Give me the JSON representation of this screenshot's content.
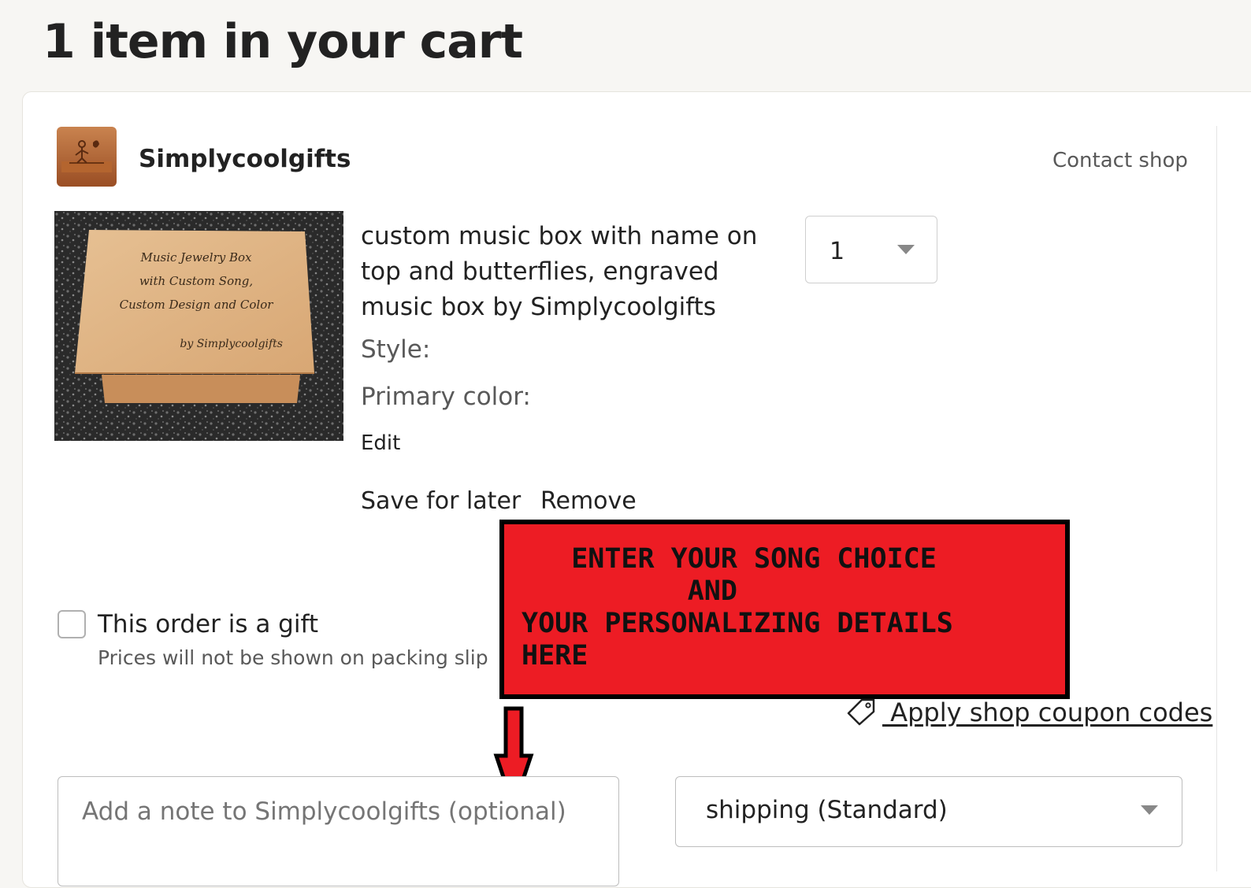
{
  "page": {
    "title": "1 item in your cart"
  },
  "shop": {
    "name": "Simplycoolgifts",
    "contact_label": "Contact shop"
  },
  "item": {
    "title": "custom music box with name on top and butterflies, engraved music box by Simplycoolgifts",
    "image_engraving": [
      "Music Jewelry Box",
      "with Custom Song,",
      "Custom Design and Color",
      "by Simplycoolgifts"
    ],
    "variations": [
      {
        "label": "Style:"
      },
      {
        "label": "Primary color:"
      }
    ],
    "edit_label": "Edit",
    "save_for_later_label": "Save for later",
    "remove_label": "Remove",
    "quantity": "1"
  },
  "gift": {
    "label": "This order is a gift",
    "sublabel": "Prices will not be shown on packing slip",
    "checked": false
  },
  "callout": {
    "lines": [
      "   ENTER YOUR SONG CHOICE",
      "          AND",
      "YOUR PERSONALIZING DETAILS",
      "HERE"
    ],
    "color": "#ed1c24"
  },
  "coupon": {
    "label": " Apply shop coupon codes"
  },
  "note": {
    "placeholder": "Add a note to Simplycoolgifts (optional)"
  },
  "shipping": {
    "selected": "shipping (Standard)"
  }
}
